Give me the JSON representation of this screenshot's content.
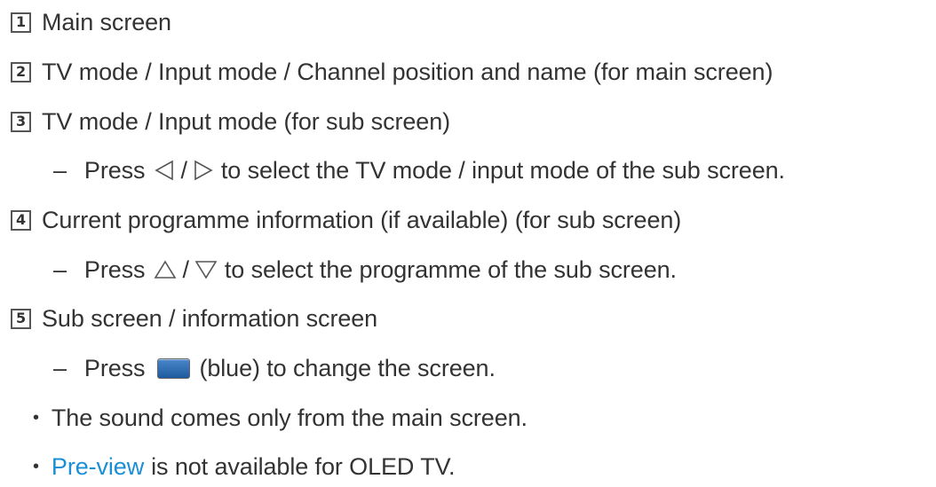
{
  "items": [
    {
      "number": "1",
      "text": "Main screen"
    },
    {
      "number": "2",
      "text": "TV mode / Input mode / Channel position and name (for main screen)"
    },
    {
      "number": "3",
      "text": "TV mode / Input mode (for sub screen)"
    },
    {
      "number": "4",
      "text": "Current programme information (if available) (for sub screen)"
    },
    {
      "number": "5",
      "text": "Sub screen / information screen"
    }
  ],
  "subnotes": {
    "dash": "–",
    "press": "Press",
    "slash": "/",
    "lr": "to select the TV mode / input mode of the sub screen.",
    "ud": "to select the programme of the sub screen.",
    "blue_label": "(blue) to change the screen."
  },
  "bullets": {
    "sound": "The sound comes only from the main screen.",
    "preview_link": "Pre-view",
    "preview_rest": "is not available for OLED TV."
  },
  "icons": {
    "left": "left-triangle-icon",
    "right": "right-triangle-icon",
    "up": "up-triangle-icon",
    "down": "down-triangle-icon",
    "blue": "blue-button-icon"
  },
  "colors": {
    "text": "#333333",
    "link": "#1a8fd6",
    "blue_button": "#2a6fb8"
  }
}
